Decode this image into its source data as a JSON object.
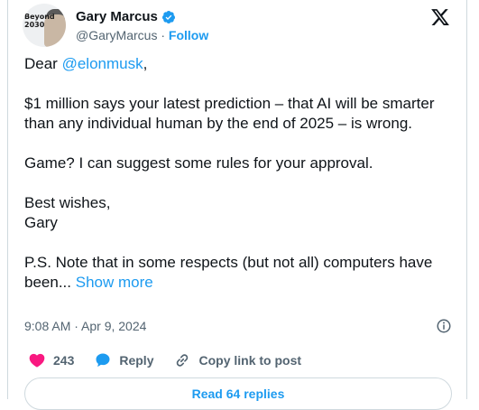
{
  "author": {
    "name": "Gary Marcus",
    "handle": "@GaryMarcus",
    "separator": "·",
    "follow_label": "Follow",
    "avatar_text": "Beyond 2030"
  },
  "tweet": {
    "greeting_prefix": "Dear ",
    "mention": "@elonmusk",
    "greeting_suffix": ",",
    "paragraph_1": "$1 million says your latest prediction – that AI will be smarter than any individual human by the end of 2025 – is wrong.",
    "paragraph_2": "Game? I can suggest some rules for your approval.",
    "signoff_line1": "Best wishes,",
    "signoff_line2": "Gary",
    "paragraph_ps": "P.S. Note that in some respects (but not all)  computers have been...",
    "show_more": "Show more"
  },
  "meta": {
    "timestamp": "9:08 AM · Apr 9, 2024"
  },
  "actions": {
    "likes": "243",
    "reply_label": "Reply",
    "copy_link_label": "Copy link to post"
  },
  "read_replies_label": "Read 64 replies",
  "colors": {
    "accent": "#1d9bf0",
    "like": "#f91880",
    "text": "#0f1419",
    "secondary": "#536471"
  },
  "icons": [
    "verified-badge-icon",
    "x-logo-icon",
    "info-icon",
    "heart-icon",
    "reply-bubble-icon",
    "link-icon"
  ]
}
